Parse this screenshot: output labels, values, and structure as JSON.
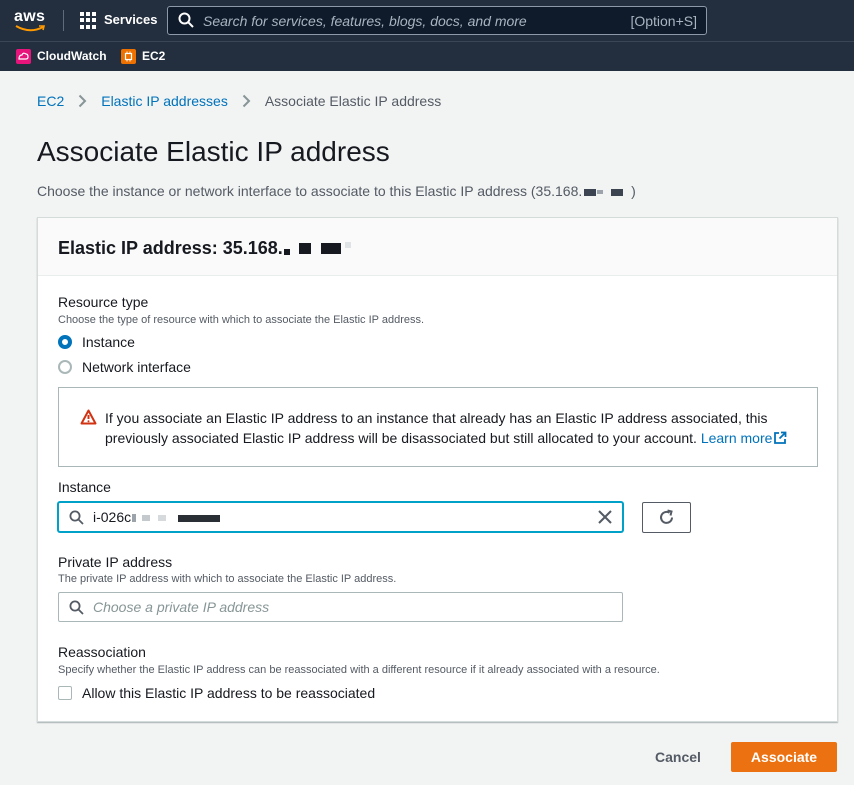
{
  "nav": {
    "logo_text": "aws",
    "services_label": "Services",
    "search_placeholder": "Search for services, features, blogs, docs, and more",
    "search_shortcut": "[Option+S]"
  },
  "favorites": [
    {
      "label": "CloudWatch",
      "color": "#e7157b"
    },
    {
      "label": "EC2",
      "color": "#ed7100"
    }
  ],
  "breadcrumb": {
    "items": [
      "EC2",
      "Elastic IP addresses"
    ],
    "current": "Associate Elastic IP address"
  },
  "page": {
    "title": "Associate Elastic IP address",
    "description_prefix": "Choose the instance or network interface to associate to this Elastic IP address (35.168.",
    "description_suffix": ")"
  },
  "panel": {
    "header_prefix": "Elastic IP address: 35.168."
  },
  "resource_type": {
    "label": "Resource type",
    "description": "Choose the type of resource with which to associate the Elastic IP address.",
    "options": [
      "Instance",
      "Network interface"
    ],
    "selected": "Instance"
  },
  "alert": {
    "text": "If you associate an Elastic IP address to an instance that already has an Elastic IP address associated, this previously associated Elastic IP address will be disassociated but still allocated to your account.",
    "link": "Learn more"
  },
  "instance": {
    "label": "Instance",
    "value": "i-026c"
  },
  "private_ip": {
    "label": "Private IP address",
    "description": "The private IP address with which to associate the Elastic IP address.",
    "placeholder": "Choose a private IP address"
  },
  "reassociation": {
    "label": "Reassociation",
    "description": "Specify whether the Elastic IP address can be reassociated with a different resource if it already associated with a resource.",
    "checkbox_label": "Allow this Elastic IP address to be reassociated",
    "checked": false
  },
  "actions": {
    "cancel": "Cancel",
    "associate": "Associate"
  },
  "colors": {
    "nav_bg": "#232f3e",
    "link": "#0073bb",
    "primary": "#ec7211",
    "focus": "#00a1c9",
    "warning": "#d13212"
  }
}
